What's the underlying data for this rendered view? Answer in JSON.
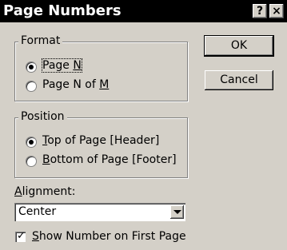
{
  "window": {
    "title": "Page Numbers",
    "help_label": "?",
    "close_label": "×"
  },
  "format": {
    "legend": "Format",
    "options": [
      {
        "pre": "Page ",
        "key": "N",
        "post": "",
        "selected": true
      },
      {
        "pre": "Page N of ",
        "key": "M",
        "post": "",
        "selected": false
      }
    ]
  },
  "position": {
    "legend": "Position",
    "options": [
      {
        "pre": "",
        "key": "T",
        "post": "op of Page [Header]",
        "selected": true
      },
      {
        "pre": "",
        "key": "B",
        "post": "ottom of Page [Footer]",
        "selected": false
      }
    ]
  },
  "alignment": {
    "label_key": "A",
    "label_rest": "lignment:",
    "value": "Center"
  },
  "first_page": {
    "key": "S",
    "rest": "how Number on First Page",
    "checked": true
  },
  "buttons": {
    "ok": "OK",
    "cancel": "Cancel"
  },
  "icons": {
    "radio_selected": "radio-selected-icon",
    "radio_empty": "radio-empty-icon",
    "dropdown": "chevron-down-icon",
    "check": "checkmark-icon"
  }
}
